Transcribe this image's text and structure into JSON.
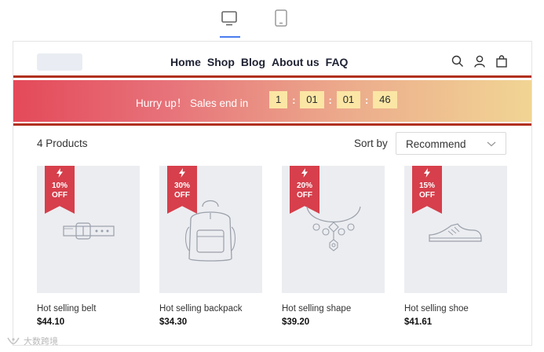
{
  "device_toggle": {
    "items": [
      {
        "name": "desktop",
        "icon": "desktop-icon",
        "selected": true
      },
      {
        "name": "tablet",
        "icon": "tablet-icon",
        "selected": false
      }
    ],
    "accent_color": "#4a7cf0"
  },
  "header": {
    "logo": "logo-placeholder",
    "nav": [
      "Home",
      "Shop",
      "Blog",
      "About us",
      "FAQ"
    ],
    "icons": [
      "search-icon",
      "user-icon",
      "bag-icon"
    ]
  },
  "banner": {
    "text": "Hurry up！ Sales end in",
    "countdown": [
      "1",
      "01",
      "01",
      "46"
    ],
    "separator": ":",
    "highlight_color": "#b1301f"
  },
  "listing": {
    "count_label": "4 Products",
    "sort_label": "Sort by",
    "sort_value": "Recommend"
  },
  "products": [
    {
      "discount": "10%",
      "off": "OFF",
      "name": "Hot selling belt",
      "price": "$44.10",
      "icon": "belt-icon"
    },
    {
      "discount": "30%",
      "off": "OFF",
      "name": "Hot selling backpack",
      "price": "$34.30",
      "icon": "backpack-icon"
    },
    {
      "discount": "20%",
      "off": "OFF",
      "name": "Hot selling shape",
      "price": "$39.20",
      "icon": "necklace-icon"
    },
    {
      "discount": "15%",
      "off": "OFF",
      "name": "Hot selling shoe",
      "price": "$41.61",
      "icon": "shoe-icon"
    }
  ],
  "watermark": {
    "text": "大数跨境"
  }
}
